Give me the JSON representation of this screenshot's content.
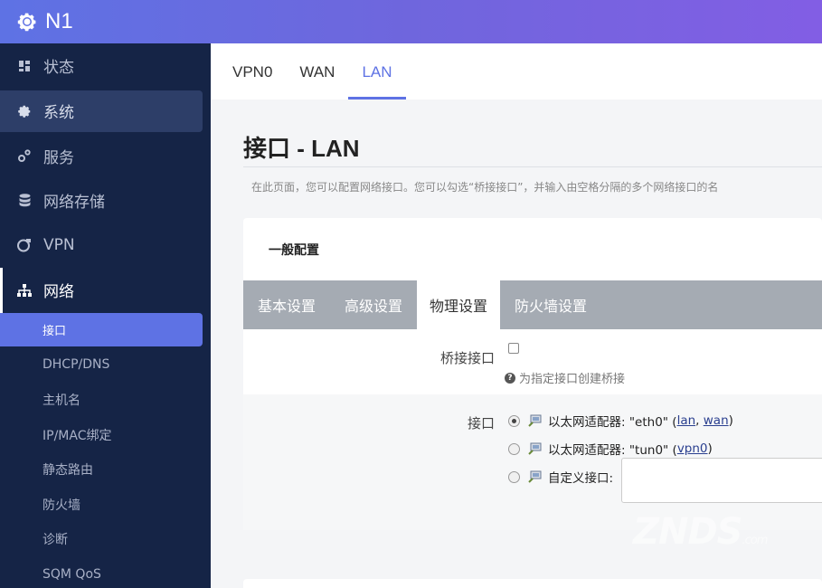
{
  "brand": {
    "title": "N1"
  },
  "sidebar": {
    "menu": [
      {
        "label": "状态",
        "icon": "dashboard-icon"
      },
      {
        "label": "系统",
        "icon": "gear-icon"
      },
      {
        "label": "服务",
        "icon": "gears-icon"
      },
      {
        "label": "网络存储",
        "icon": "database-icon"
      },
      {
        "label": "VPN",
        "icon": "globe-lock-icon"
      },
      {
        "label": "网络",
        "icon": "sitemap-icon"
      }
    ],
    "submenu": [
      {
        "label": "接口"
      },
      {
        "label": "DHCP/DNS"
      },
      {
        "label": "主机名"
      },
      {
        "label": "IP/MAC绑定"
      },
      {
        "label": "静态路由"
      },
      {
        "label": "防火墙"
      },
      {
        "label": "诊断"
      },
      {
        "label": "SQM QoS"
      }
    ]
  },
  "top_tabs": [
    {
      "label": "VPN0"
    },
    {
      "label": "WAN"
    },
    {
      "label": "LAN"
    }
  ],
  "page": {
    "title": "接口 - LAN",
    "description": "在此页面，您可以配置网络接口。您可以勾选“桥接接口”，并输入由空格分隔的多个网络接口的名"
  },
  "card": {
    "title": "一般配置",
    "tabs": [
      {
        "label": "基本设置"
      },
      {
        "label": "高级设置"
      },
      {
        "label": "物理设置"
      },
      {
        "label": "防火墙设置"
      }
    ],
    "bridge": {
      "label": "桥接接口",
      "hint": "为指定接口创建桥接"
    },
    "interface": {
      "label": "接口",
      "options": [
        {
          "prefix": "以太网适配器: \"eth0\" (",
          "link1": "lan",
          "sep": ", ",
          "link2": "wan",
          "suffix": ")"
        },
        {
          "prefix": "以太网适配器: \"tun0\" (",
          "link1": "vpn0",
          "suffix": ")"
        },
        {
          "prefix": "自定义接口:"
        }
      ]
    }
  },
  "watermark": {
    "text": "ZNDS",
    "suffix": ".com"
  },
  "colors": {
    "accent": "#5e72e4",
    "sidebar_bg": "#152446",
    "subtabs_bg": "#a5abb3"
  }
}
